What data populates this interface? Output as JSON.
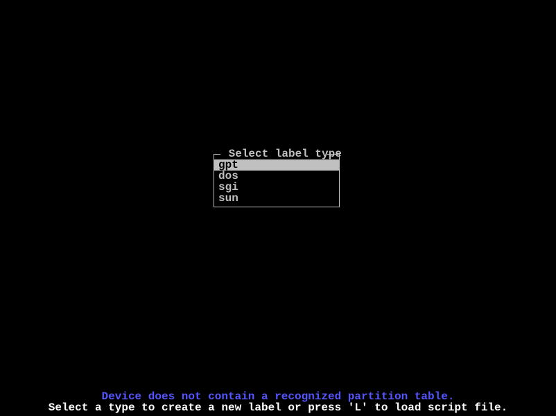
{
  "dialog": {
    "title": " Select label type ",
    "items": [
      {
        "label": "gpt",
        "selected": true
      },
      {
        "label": "dos",
        "selected": false
      },
      {
        "label": "sgi",
        "selected": false
      },
      {
        "label": "sun",
        "selected": false
      }
    ]
  },
  "footer": {
    "status": "Device does not contain a recognized partition table.",
    "hint": "Select a type to create a new label or press 'L' to load script file."
  }
}
